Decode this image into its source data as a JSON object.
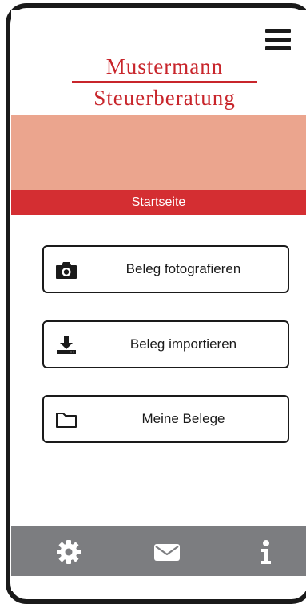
{
  "header": {
    "brand_line1": "Mustermann",
    "brand_line2": "Steuerberatung",
    "menu_icon": "hamburger-menu-icon"
  },
  "page": {
    "title": "Startseite"
  },
  "actions": [
    {
      "label": "Beleg fotografieren",
      "icon": "camera-icon"
    },
    {
      "label": "Beleg importieren",
      "icon": "download-icon"
    },
    {
      "label": "Meine Belege",
      "icon": "folder-icon"
    }
  ],
  "footer": {
    "items": [
      {
        "icon": "gear-icon"
      },
      {
        "icon": "envelope-icon"
      },
      {
        "icon": "info-icon"
      }
    ]
  },
  "colors": {
    "brand_red": "#c8252b",
    "banner": "#eba58e",
    "title_bar": "#d42e32",
    "footer": "#7c7d80"
  }
}
